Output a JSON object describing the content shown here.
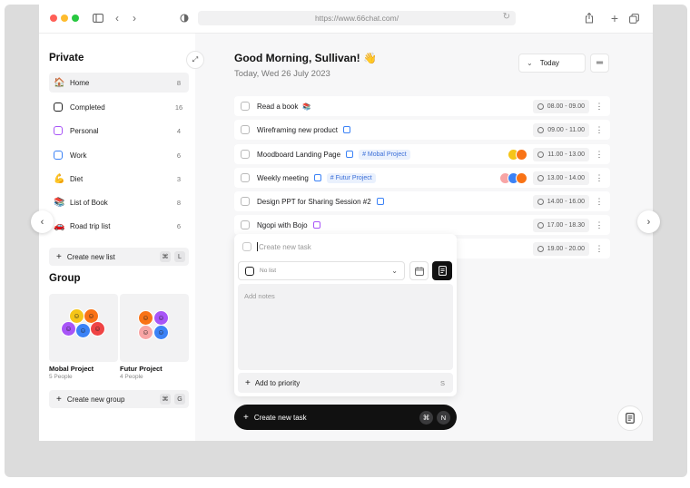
{
  "browser": {
    "url": "https://www.66chat.com/"
  },
  "sidebar": {
    "private_title": "Private",
    "items": [
      {
        "label": "Home",
        "count": "8",
        "icon": "house-emoji"
      },
      {
        "label": "Completed",
        "count": "16",
        "icon": "box-black"
      },
      {
        "label": "Personal",
        "count": "4",
        "icon": "box-purple"
      },
      {
        "label": "Work",
        "count": "6",
        "icon": "box-blue"
      },
      {
        "label": "Diet",
        "count": "3",
        "icon": "muscle-emoji"
      },
      {
        "label": "List of Book",
        "count": "8",
        "icon": "books-emoji"
      },
      {
        "label": "Road trip list",
        "count": "6",
        "icon": "car-emoji"
      }
    ],
    "create_list": {
      "label": "Create new list",
      "key1": "⌘",
      "key2": "L"
    },
    "group_title": "Group",
    "groups": [
      {
        "name": "Mobal Project",
        "members": "5 People"
      },
      {
        "name": "Futur Project",
        "members": "4 People"
      }
    ],
    "create_group": {
      "label": "Create new group",
      "key1": "⌘",
      "key2": "G"
    }
  },
  "header": {
    "greeting": "Good Morning, Sullivan! 👋",
    "date": "Today, Wed 26 July 2023",
    "filter": "Today"
  },
  "tasks": [
    {
      "title": "Read a book",
      "emoji": "📚",
      "tag": "",
      "time": "08.00 - 09.00"
    },
    {
      "title": "Wireframing new product",
      "emoji": "",
      "tag": "",
      "time": "09.00 - 11.00"
    },
    {
      "title": "Moodboard Landing Page",
      "emoji": "",
      "tag": "# Mobal Project",
      "time": "11.00 - 13.00"
    },
    {
      "title": "Weekly meeting",
      "emoji": "",
      "tag": "# Futur Project",
      "time": "13.00 - 14.00"
    },
    {
      "title": "Design PPT for Sharing Session #2",
      "emoji": "",
      "tag": "",
      "time": "14.00 - 16.00"
    },
    {
      "title": "Ngopi with Bojo",
      "emoji": "",
      "tag": "",
      "time": "17.00 - 18.30"
    },
    {
      "title": "",
      "emoji": "",
      "tag": "",
      "time": "19.00 - 20.00"
    }
  ],
  "new_task_popup": {
    "placeholder": "Create new task",
    "list_placeholder": "No list",
    "notes_placeholder": "Add notes",
    "priority_label": "Add to priority",
    "priority_key": "S"
  },
  "create_task_bar": {
    "label": "Create new task",
    "key1": "⌘",
    "key2": "N"
  },
  "colors": {
    "accent_blue": "#3b82f6",
    "purple": "#a855f7",
    "dark": "#111111"
  }
}
